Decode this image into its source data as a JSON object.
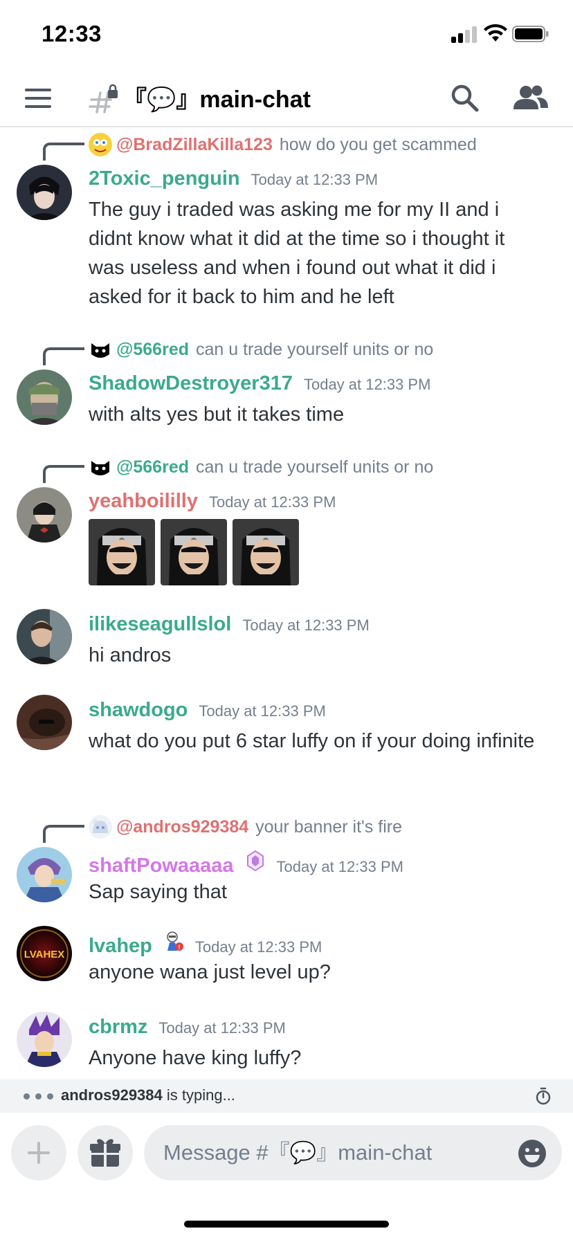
{
  "status_bar": {
    "time": "12:33"
  },
  "header": {
    "channel_name": "『💬』main-chat"
  },
  "colors": {
    "teal": "#3aaa8e",
    "salmon": "#e07070",
    "pink": "#d477e8",
    "gray_text": "#747f8d"
  },
  "messages": [
    {
      "reply": {
        "author": "@BradZillaKilla123",
        "text": "how do you get scammed"
      },
      "author": "2Toxic_penguin",
      "timestamp": "Today at 12:33 PM",
      "content": "The guy i traded was asking me for my II and i didnt know what it did at the time so i thought it was useless and when i found out what it did i asked for it back to him and he left"
    },
    {
      "reply": {
        "author": "@566red",
        "text": "can u trade yourself units or no"
      },
      "author": "ShadowDestroyer317",
      "timestamp": "Today at 12:33 PM",
      "content": "with alts yes but it takes time"
    },
    {
      "reply": {
        "author": "@566red",
        "text": "can u trade yourself units or no"
      },
      "author": "yeahboililly",
      "timestamp": "Today at 12:33 PM",
      "content": ""
    },
    {
      "author": "ilikeseagullslol",
      "timestamp": "Today at 12:33 PM",
      "content": "hi andros"
    },
    {
      "author": "shawdogo",
      "timestamp": "Today at 12:33 PM",
      "content": "what do you put 6 star luffy on if your doing infinite"
    },
    {
      "reply": {
        "author": "@andros929384",
        "text": "your banner it's fire"
      },
      "author": "shaftPowaaaaa",
      "timestamp": "Today at 12:33 PM",
      "content": "Sap saying that"
    },
    {
      "author": "lvahep",
      "timestamp": "Today at 12:33 PM",
      "content": "anyone wana just level up?",
      "avatar_text": "LVAHEX"
    },
    {
      "author": "cbrmz",
      "timestamp": "Today at 12:33 PM",
      "content": "Anyone have king luffy?"
    }
  ],
  "typing": {
    "user": "andros929384",
    "suffix": " is typing..."
  },
  "composer": {
    "placeholder": "Message #『💬』main-chat"
  }
}
